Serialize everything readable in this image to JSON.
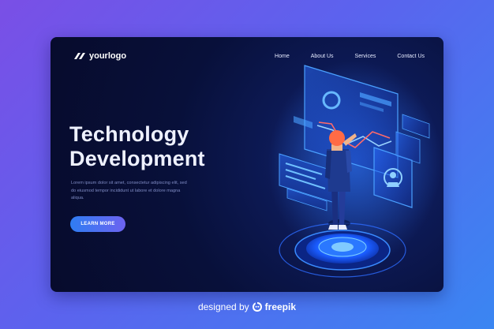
{
  "brand": {
    "name": "yourlogo"
  },
  "nav": {
    "items": [
      {
        "label": "Home"
      },
      {
        "label": "About Us"
      },
      {
        "label": "Services"
      },
      {
        "label": "Contact Us"
      }
    ]
  },
  "hero": {
    "title_line1": "Technology",
    "title_line2": "Development",
    "description_line1": "Lorem ipsum dolor sit amet, consectetur adipiscing elit, sed",
    "description_line2": "do eiusmod tempor incididunt ut labore et dolore magna",
    "description_line3": "aliqua.",
    "button_label": "LEARN MORE"
  },
  "illustration": {
    "icon": "person-with-holographic-screens-illustration"
  },
  "footer": {
    "credit_prefix": "designed by",
    "credit_brand": "freepik",
    "icon": "freepik-logo-icon"
  },
  "colors": {
    "background_start": "#7a4fe6",
    "background_end": "#3a86f2",
    "card": "#08103a",
    "accent": "#2f7df3",
    "button_end": "#6d63f0"
  }
}
